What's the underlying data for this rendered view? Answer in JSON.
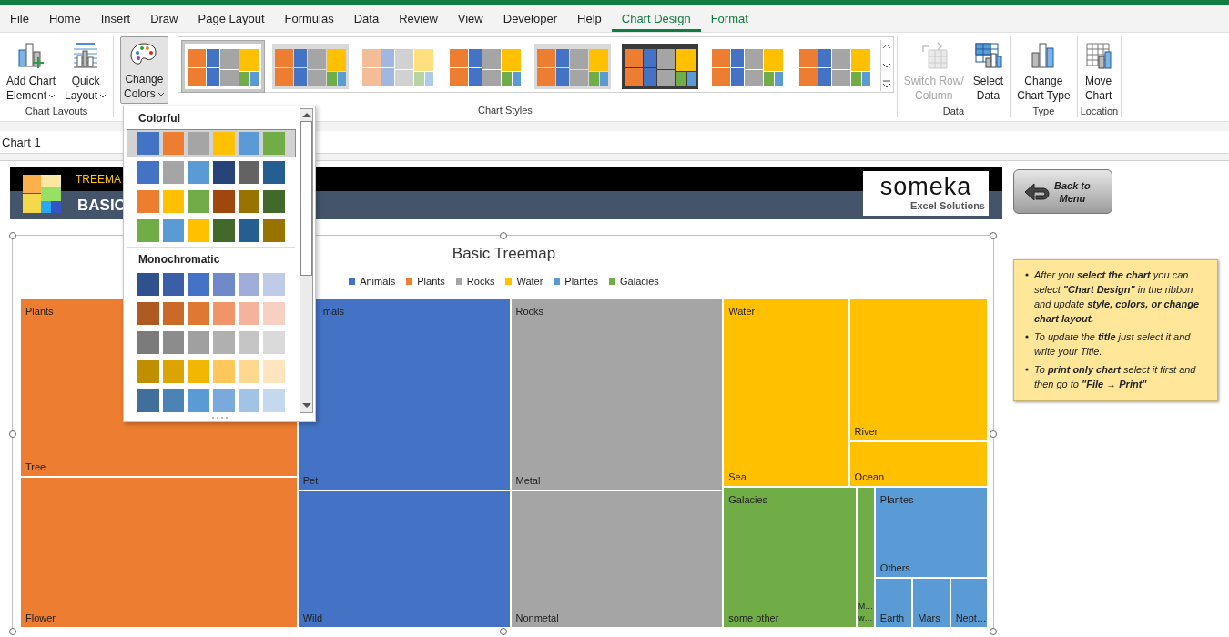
{
  "tabs": [
    {
      "label": "File",
      "selected": false,
      "contextual": false
    },
    {
      "label": "Home",
      "selected": false,
      "contextual": false
    },
    {
      "label": "Insert",
      "selected": false,
      "contextual": false
    },
    {
      "label": "Draw",
      "selected": false,
      "contextual": false
    },
    {
      "label": "Page Layout",
      "selected": false,
      "contextual": false
    },
    {
      "label": "Formulas",
      "selected": false,
      "contextual": false
    },
    {
      "label": "Data",
      "selected": false,
      "contextual": false
    },
    {
      "label": "Review",
      "selected": false,
      "contextual": false
    },
    {
      "label": "View",
      "selected": false,
      "contextual": false
    },
    {
      "label": "Developer",
      "selected": false,
      "contextual": false
    },
    {
      "label": "Help",
      "selected": false,
      "contextual": false
    },
    {
      "label": "Chart Design",
      "selected": true,
      "contextual": true
    },
    {
      "label": "Format",
      "selected": false,
      "contextual": true
    }
  ],
  "ribbon": {
    "groups": [
      {
        "label": "Chart Layouts",
        "kind": "buttons",
        "buttons": [
          {
            "label": "Add Chart\nElement",
            "dropdown": true,
            "disabled": false
          },
          {
            "label": "Quick\nLayout",
            "dropdown": true,
            "disabled": false
          }
        ]
      },
      {
        "label": "Chart Styles",
        "kind": "styles",
        "color_button": {
          "label": "Change\nColors",
          "dropdown": true,
          "expanded": true
        },
        "styles": [
          {
            "kind": "light",
            "selected": true
          },
          {
            "kind": "gray",
            "selected": false
          },
          {
            "kind": "pale",
            "selected": false
          },
          {
            "kind": "light",
            "selected": false
          },
          {
            "kind": "gray",
            "selected": false
          },
          {
            "kind": "dark",
            "selected": false
          },
          {
            "kind": "light",
            "selected": false
          },
          {
            "kind": "light",
            "selected": false
          }
        ]
      },
      {
        "label": "Data",
        "kind": "buttons",
        "buttons": [
          {
            "label": "Switch Row/\nColumn",
            "dropdown": false,
            "disabled": true
          },
          {
            "label": "Select\nData",
            "dropdown": false,
            "disabled": false
          }
        ]
      },
      {
        "label": "Type",
        "kind": "buttons",
        "buttons": [
          {
            "label": "Change\nChart Type",
            "dropdown": false,
            "disabled": false
          }
        ]
      },
      {
        "label": "Location",
        "kind": "buttons",
        "buttons": [
          {
            "label": "Move\nChart",
            "dropdown": false,
            "disabled": false
          }
        ]
      }
    ]
  },
  "name_box": "Chart 1",
  "color_dropdown": {
    "sections": [
      {
        "heading": "Colorful",
        "palettes": [
          {
            "selected": true,
            "swatches": [
              {
                "color": "#4472c4"
              },
              {
                "color": "#ed7d31"
              },
              {
                "color": "#a5a5a5"
              },
              {
                "color": "#ffc000"
              },
              {
                "color": "#5b9bd5"
              },
              {
                "color": "#70ad47"
              }
            ]
          },
          {
            "selected": false,
            "swatches": [
              {
                "color": "#4472c4"
              },
              {
                "color": "#a5a5a5"
              },
              {
                "color": "#5b9bd5"
              },
              {
                "color": "#264478"
              },
              {
                "color": "#636363"
              },
              {
                "color": "#255e91"
              }
            ]
          },
          {
            "selected": false,
            "swatches": [
              {
                "color": "#ed7d31"
              },
              {
                "color": "#ffc000"
              },
              {
                "color": "#70ad47"
              },
              {
                "color": "#9e480e"
              },
              {
                "color": "#997300"
              },
              {
                "color": "#43682b"
              }
            ]
          },
          {
            "selected": false,
            "swatches": [
              {
                "color": "#70ad47"
              },
              {
                "color": "#5b9bd5"
              },
              {
                "color": "#ffc000"
              },
              {
                "color": "#43682b"
              },
              {
                "color": "#255e91"
              },
              {
                "color": "#997300"
              }
            ]
          }
        ]
      },
      {
        "heading": "Monochromatic",
        "palettes": [
          {
            "selected": false,
            "swatches": [
              {
                "color": "#2f528f"
              },
              {
                "color": "#3a5fa8"
              },
              {
                "color": "#4472c4"
              },
              {
                "color": "#6f89c9"
              },
              {
                "color": "#9faed9"
              },
              {
                "color": "#c0cbe8"
              }
            ]
          },
          {
            "selected": false,
            "swatches": [
              {
                "color": "#ae5a21"
              },
              {
                "color": "#cb6928"
              },
              {
                "color": "#e07732"
              },
              {
                "color": "#f0946a"
              },
              {
                "color": "#f4b39a"
              },
              {
                "color": "#f8d0c1"
              }
            ]
          },
          {
            "selected": false,
            "swatches": [
              {
                "color": "#7b7b7b"
              },
              {
                "color": "#8c8c8c"
              },
              {
                "color": "#a0a0a0"
              },
              {
                "color": "#b0b0b0"
              },
              {
                "color": "#c5c5c5"
              },
              {
                "color": "#dadada"
              }
            ]
          },
          {
            "selected": false,
            "swatches": [
              {
                "color": "#bf8f00"
              },
              {
                "color": "#dba400"
              },
              {
                "color": "#f2b700"
              },
              {
                "color": "#ffc65c"
              },
              {
                "color": "#ffd890"
              },
              {
                "color": "#ffe5bf"
              }
            ]
          },
          {
            "selected": false,
            "swatches": [
              {
                "color": "#416f9c"
              },
              {
                "color": "#4c83b6"
              },
              {
                "color": "#5b9bd5"
              },
              {
                "color": "#7aaadb"
              },
              {
                "color": "#a3c3e6"
              },
              {
                "color": "#c4d8ee"
              }
            ]
          }
        ]
      }
    ]
  },
  "banner": {
    "title": "TREEMA",
    "subtitle": "BASIC",
    "brand": "someka",
    "brand_tagline": "Excel Solutions"
  },
  "back_button": {
    "label": "Back to\nMenu"
  },
  "chart": {
    "title": "Basic Treemap",
    "legend": [
      {
        "label": "Animals",
        "color": "#4472c4"
      },
      {
        "label": "Plants",
        "color": "#ed7d31"
      },
      {
        "label": "Rocks",
        "color": "#a5a5a5"
      },
      {
        "label": "Water",
        "color": "#ffc000"
      },
      {
        "label": "Plantes",
        "color": "#5b9bd5"
      },
      {
        "label": "Galacies",
        "color": "#70ad47"
      }
    ],
    "groups": [
      {
        "label": "Plants",
        "color": "#ed7d31",
        "tiles": [
          "Tree",
          "Flower"
        ]
      },
      {
        "label": "mals",
        "color": "#4472c4",
        "tiles": [
          "Pet",
          "Wild"
        ]
      },
      {
        "label": "Rocks",
        "color": "#a5a5a5",
        "tiles": [
          "Metal",
          "Nonmetal"
        ]
      },
      {
        "label": "Water",
        "color": "#ffc000",
        "tiles": [
          "Sea",
          "River",
          "Ocean"
        ]
      },
      {
        "label": "Galacies",
        "color": "#70ad47",
        "tiles": [
          "some other",
          "M… w…"
        ]
      },
      {
        "label": "Plantes",
        "color": "#5b9bd5",
        "tiles": [
          "Others",
          "Earth",
          "Mars",
          "Nept…"
        ]
      }
    ]
  },
  "notes": [
    "After you **select the chart** you can select **\"Chart Design\"** in the ribbon and update **style, colors,  or change chart layout.**",
    "To update the **title** just select it and write your Title.",
    "To **print only chart** select it first and then go to **\"File → Print\"**"
  ]
}
